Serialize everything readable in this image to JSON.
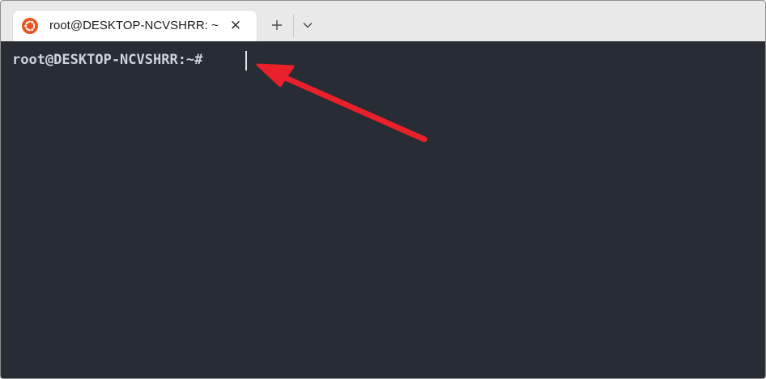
{
  "tab": {
    "icon": "ubuntu-icon",
    "title": "root@DESKTOP-NCVSHRR: ~",
    "close_symbol": "✕"
  },
  "toolbar": {
    "new_tab_icon": "plus-icon",
    "dropdown_icon": "chevron-down-icon"
  },
  "terminal": {
    "prompt": "root@DESKTOP-NCVSHRR:~#",
    "background_color": "#282c34",
    "text_color": "#d0d3da"
  },
  "annotation": {
    "type": "arrow",
    "color": "#e8202a"
  }
}
